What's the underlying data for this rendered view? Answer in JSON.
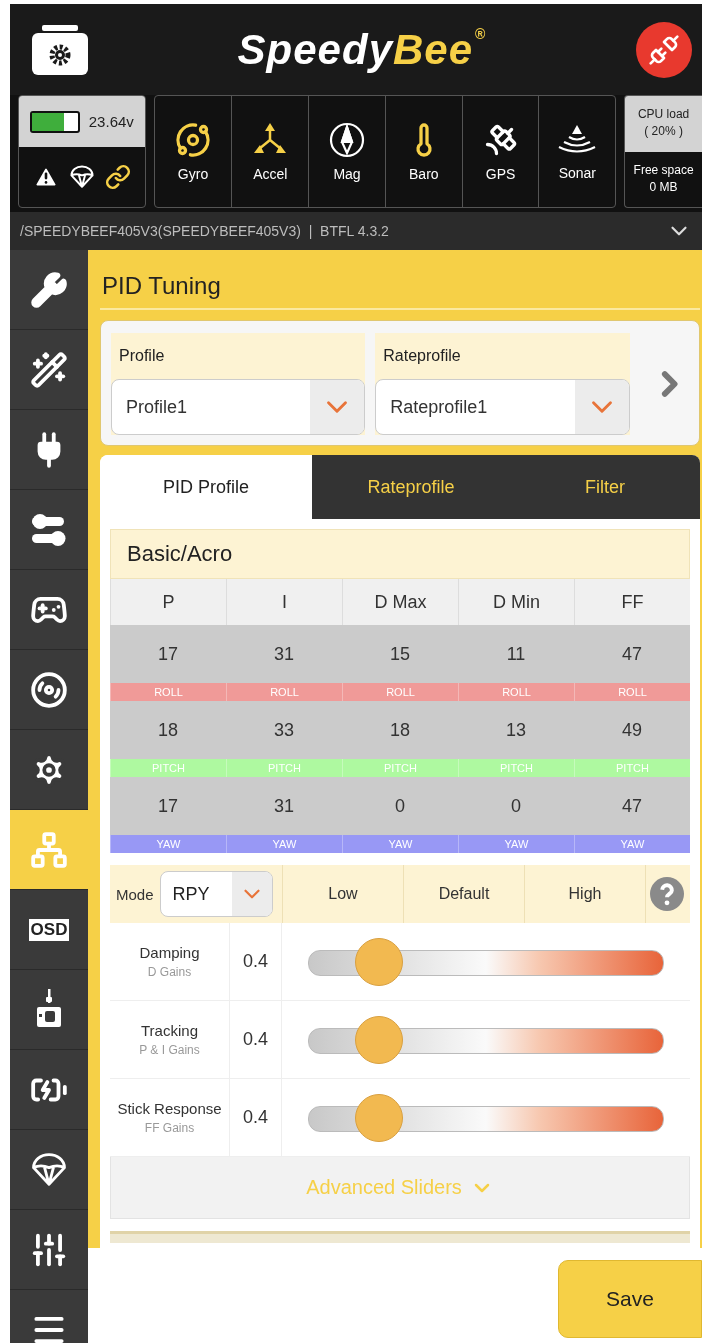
{
  "header": {
    "logo": {
      "parts": [
        {
          "text": "Speedy",
          "highlight": false
        },
        {
          "text": "Bee",
          "highlight": true
        }
      ],
      "mark": "®"
    },
    "connected": false
  },
  "status": {
    "battery": {
      "level": 0.7,
      "voltage": "23.64v"
    },
    "indicators": [
      {
        "kind": "warning",
        "active": false
      },
      {
        "kind": "parachute",
        "active": false
      },
      {
        "kind": "link",
        "active": true
      }
    ],
    "sensors": [
      {
        "name": "Gyro",
        "kind": "gyro",
        "active": true
      },
      {
        "name": "Accel",
        "kind": "accel",
        "active": true
      },
      {
        "name": "Mag",
        "kind": "mag",
        "active": false
      },
      {
        "name": "Baro",
        "kind": "baro",
        "active": true
      },
      {
        "name": "GPS",
        "kind": "gps",
        "active": false
      },
      {
        "name": "Sonar",
        "kind": "sonar",
        "active": false
      }
    ],
    "cpu": {
      "label": "CPU load",
      "value": "( 20% )"
    },
    "space": {
      "label": "Free space",
      "value": "0 MB"
    }
  },
  "device_bar": {
    "text": "/SPEEDYBEEF405V3(SPEEDYBEEF405V3)  |  BTFL 4.3.2"
  },
  "sidebar": [
    {
      "kind": "wrench",
      "selected": false
    },
    {
      "kind": "wand",
      "selected": false
    },
    {
      "kind": "plug",
      "selected": false
    },
    {
      "kind": "toggles",
      "selected": false
    },
    {
      "kind": "remote",
      "selected": false
    },
    {
      "kind": "motor",
      "selected": false
    },
    {
      "kind": "gear",
      "selected": false
    },
    {
      "kind": "tree",
      "selected": true
    },
    {
      "kind": "osd",
      "label": "OSD",
      "selected": false
    },
    {
      "kind": "vtx",
      "selected": false
    },
    {
      "kind": "battery",
      "selected": false
    },
    {
      "kind": "parachute",
      "selected": false
    },
    {
      "kind": "sliders",
      "selected": false
    },
    {
      "kind": "menu",
      "selected": false
    }
  ],
  "page_title": "PID Tuning",
  "profiles": [
    {
      "label": "Profile",
      "value": "Profile1"
    },
    {
      "label": "Rateprofile",
      "value": "Rateprofile1"
    }
  ],
  "tabs": [
    {
      "label": "PID Profile",
      "selected": true
    },
    {
      "label": "Rateprofile",
      "selected": false
    },
    {
      "label": "Filter",
      "selected": false
    }
  ],
  "pid_section": {
    "title": "Basic/Acro",
    "columns": [
      "P",
      "I",
      "D Max",
      "D Min",
      "FF"
    ],
    "rows": [
      {
        "values": [
          "17",
          "31",
          "15",
          "11",
          "47"
        ],
        "axis": [
          "ROLL",
          "ROLL",
          "ROLL",
          "ROLL",
          "ROLL"
        ],
        "color": "#f09a98"
      },
      {
        "values": [
          "18",
          "33",
          "18",
          "13",
          "49"
        ],
        "axis": [
          "PITCH",
          "PITCH",
          "PITCH",
          "PITCH",
          "PITCH"
        ],
        "color": "#aef9a0"
      },
      {
        "values": [
          "17",
          "31",
          "0",
          "0",
          "47"
        ],
        "axis": [
          "YAW",
          "YAW",
          "YAW",
          "YAW",
          "YAW"
        ],
        "color": "#9898f5"
      }
    ]
  },
  "slider_section": {
    "mode_label": "Mode",
    "mode": "RPY",
    "levels": [
      "Low",
      "Default",
      "High"
    ],
    "sliders": [
      {
        "name": "Damping",
        "sub": "D Gains",
        "reading": "0.4",
        "level": 0.2
      },
      {
        "name": "Tracking",
        "sub": "P & I Gains",
        "reading": "0.4",
        "level": 0.2
      },
      {
        "name": "Stick Response",
        "sub": "FF Gains",
        "reading": "0.4",
        "level": 0.2
      }
    ],
    "advanced": "Advanced Sliders"
  },
  "save": "Save"
}
